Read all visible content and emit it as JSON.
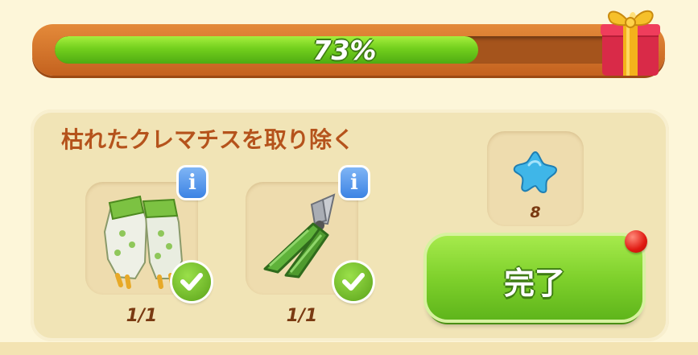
{
  "progress": {
    "label": "73%",
    "value": 0.73
  },
  "task": {
    "title": "枯れたクレマチスを取り除く",
    "items": [
      {
        "icon": "garden-gloves-icon",
        "count": "1/1",
        "completed": true
      },
      {
        "icon": "pruning-shears-icon",
        "count": "1/1",
        "completed": true
      }
    ]
  },
  "reward": {
    "icon": "blue-star-icon",
    "amount": "8"
  },
  "complete_button": {
    "label": "完了"
  },
  "colors": {
    "progress_fill": "#72cf1d",
    "frame": "#d9772c",
    "title": "#b5531c",
    "button": "#7fd12c",
    "info": "#3c83e4",
    "notify": "#e01a12"
  }
}
